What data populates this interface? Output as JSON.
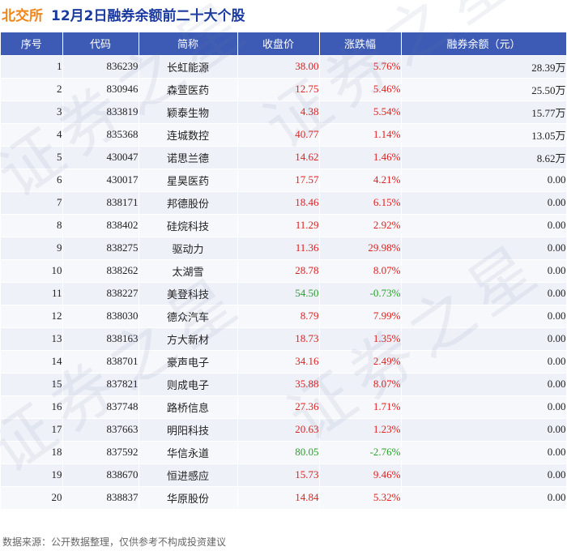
{
  "header": {
    "brand": "北交所",
    "title": "12月2日融券余额前二十大个股"
  },
  "table": {
    "columns": [
      "序号",
      "代码",
      "简称",
      "收盘价",
      "涨跌幅",
      "融券余额（元）"
    ],
    "rows": [
      {
        "idx": "1",
        "code": "836239",
        "name": "长虹能源",
        "price": "38.00",
        "chg": "5.76%",
        "bal": "28.39万",
        "dir": "up"
      },
      {
        "idx": "2",
        "code": "830946",
        "name": "森萱医药",
        "price": "12.75",
        "chg": "5.46%",
        "bal": "25.50万",
        "dir": "up"
      },
      {
        "idx": "3",
        "code": "833819",
        "name": "颖泰生物",
        "price": "4.38",
        "chg": "5.54%",
        "bal": "15.77万",
        "dir": "up"
      },
      {
        "idx": "4",
        "code": "835368",
        "name": "连城数控",
        "price": "40.77",
        "chg": "1.14%",
        "bal": "13.05万",
        "dir": "up"
      },
      {
        "idx": "5",
        "code": "430047",
        "name": "诺思兰德",
        "price": "14.62",
        "chg": "1.46%",
        "bal": "8.62万",
        "dir": "up"
      },
      {
        "idx": "6",
        "code": "430017",
        "name": "星昊医药",
        "price": "17.57",
        "chg": "4.21%",
        "bal": "0.00",
        "dir": "up"
      },
      {
        "idx": "7",
        "code": "838171",
        "name": "邦德股份",
        "price": "18.46",
        "chg": "6.15%",
        "bal": "0.00",
        "dir": "up"
      },
      {
        "idx": "8",
        "code": "838402",
        "name": "硅烷科技",
        "price": "11.29",
        "chg": "2.92%",
        "bal": "0.00",
        "dir": "up"
      },
      {
        "idx": "9",
        "code": "838275",
        "name": "驱动力",
        "price": "11.36",
        "chg": "29.98%",
        "bal": "0.00",
        "dir": "up"
      },
      {
        "idx": "10",
        "code": "838262",
        "name": "太湖雪",
        "price": "28.78",
        "chg": "8.07%",
        "bal": "0.00",
        "dir": "up"
      },
      {
        "idx": "11",
        "code": "838227",
        "name": "美登科技",
        "price": "54.50",
        "chg": "-0.73%",
        "bal": "0.00",
        "dir": "down"
      },
      {
        "idx": "12",
        "code": "838030",
        "name": "德众汽车",
        "price": "8.79",
        "chg": "7.99%",
        "bal": "0.00",
        "dir": "up"
      },
      {
        "idx": "13",
        "code": "838163",
        "name": "方大新材",
        "price": "18.73",
        "chg": "1.35%",
        "bal": "0.00",
        "dir": "up"
      },
      {
        "idx": "14",
        "code": "838701",
        "name": "豪声电子",
        "price": "34.16",
        "chg": "2.49%",
        "bal": "0.00",
        "dir": "up"
      },
      {
        "idx": "15",
        "code": "837821",
        "name": "则成电子",
        "price": "35.88",
        "chg": "8.07%",
        "bal": "0.00",
        "dir": "up"
      },
      {
        "idx": "16",
        "code": "837748",
        "name": "路桥信息",
        "price": "27.36",
        "chg": "1.71%",
        "bal": "0.00",
        "dir": "up"
      },
      {
        "idx": "17",
        "code": "837663",
        "name": "明阳科技",
        "price": "20.63",
        "chg": "1.23%",
        "bal": "0.00",
        "dir": "up"
      },
      {
        "idx": "18",
        "code": "837592",
        "name": "华信永道",
        "price": "80.05",
        "chg": "-2.76%",
        "bal": "0.00",
        "dir": "down"
      },
      {
        "idx": "19",
        "code": "838670",
        "name": "恒进感应",
        "price": "15.73",
        "chg": "9.46%",
        "bal": "0.00",
        "dir": "up"
      },
      {
        "idx": "20",
        "code": "838837",
        "name": "华原股份",
        "price": "14.84",
        "chg": "5.32%",
        "bal": "0.00",
        "dir": "up"
      }
    ]
  },
  "footer": "数据来源：公开数据整理，仅供参考不构成投资建议",
  "watermark": "证券之星",
  "colors": {
    "brand": "#f08519",
    "title": "#1a3aa0",
    "header_bg": "#3d5bb5",
    "up": "#e02020",
    "down": "#2aa12a"
  }
}
